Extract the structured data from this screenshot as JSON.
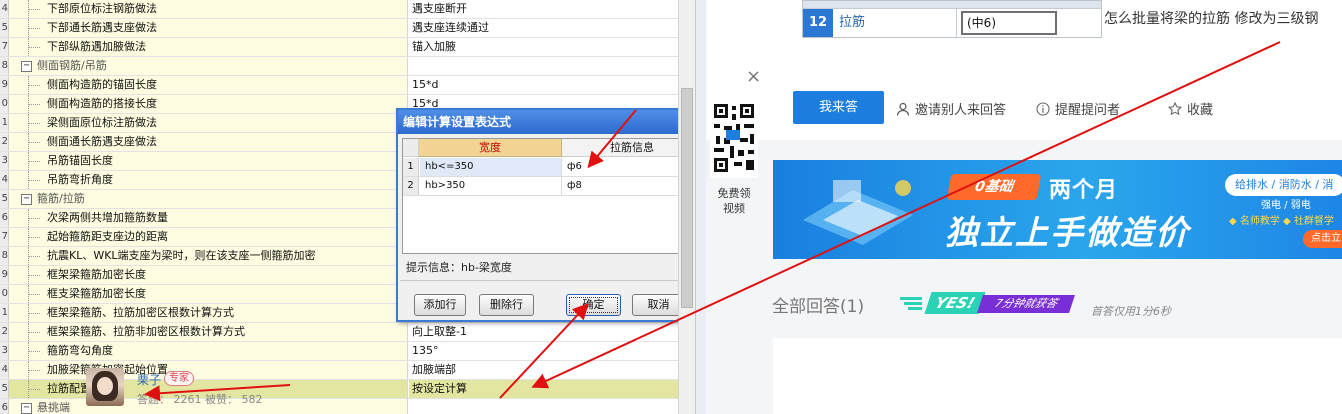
{
  "settings_grid": {
    "rows": [
      {
        "num": "4",
        "label": "下部原位标注钢筋做法",
        "value": "遇支座断开",
        "kind": "item"
      },
      {
        "num": "5",
        "label": "下部通长筋遇支座做法",
        "value": "遇支座连续通过",
        "kind": "item"
      },
      {
        "num": "7",
        "label": "下部纵筋遇加腋做法",
        "value": "锚入加腋",
        "kind": "item"
      },
      {
        "num": "8",
        "label": "侧面钢筋/吊筋",
        "value": "",
        "kind": "section"
      },
      {
        "num": "9",
        "label": "侧面构造筋的锚固长度",
        "value": "15*d",
        "kind": "item"
      },
      {
        "num": "0",
        "label": "侧面构造筋的搭接长度",
        "value": "15*d",
        "kind": "item"
      },
      {
        "num": "1",
        "label": "梁侧面原位标注筋做法",
        "value": "",
        "kind": "item"
      },
      {
        "num": "2",
        "label": "侧面通长筋遇支座做法",
        "value": "",
        "kind": "item"
      },
      {
        "num": "3",
        "label": "吊筋锚固长度",
        "value": "",
        "kind": "item"
      },
      {
        "num": "4",
        "label": "吊筋弯折角度",
        "value": "",
        "kind": "item"
      },
      {
        "num": "5",
        "label": "箍筋/拉筋",
        "value": "",
        "kind": "section"
      },
      {
        "num": "6",
        "label": "次梁两侧共增加箍筋数量",
        "value": "",
        "kind": "item"
      },
      {
        "num": "7",
        "label": "起始箍筋距支座边的距离",
        "value": "",
        "kind": "item"
      },
      {
        "num": "8",
        "label": "抗震KL、WKL端支座为梁时，则在该支座一侧箍筋加密",
        "value": "",
        "kind": "item"
      },
      {
        "num": "9",
        "label": "框架梁箍筋加密长度",
        "value": "",
        "kind": "item"
      },
      {
        "num": "0",
        "label": "框支梁箍筋加密长度",
        "value": "",
        "kind": "item"
      },
      {
        "num": "1",
        "label": "框架梁箍筋、拉筋加密区根数计算方式",
        "value": "",
        "kind": "item"
      },
      {
        "num": "2",
        "label": "框架梁箍筋、拉筋非加密区根数计算方式",
        "value": "向上取整-1",
        "kind": "item"
      },
      {
        "num": "3",
        "label": "箍筋弯勾角度",
        "value": "135°",
        "kind": "item"
      },
      {
        "num": "4",
        "label": "加腋梁箍筋加密起始位置",
        "value": "加腋端部",
        "kind": "item"
      },
      {
        "num": "5",
        "label": "拉筋配置",
        "value": "按设定计算",
        "kind": "item",
        "highlight": true
      },
      {
        "num": "6",
        "label": "悬挑端",
        "value": "",
        "kind": "section"
      }
    ]
  },
  "dialog": {
    "title": "编辑计算设置表达式",
    "close_glyph": "✕",
    "col_width": "宽度",
    "col_tie": "拉筋信息",
    "rows": [
      {
        "n": "1",
        "width": "hb<=350",
        "tie": "ф6"
      },
      {
        "n": "2",
        "width": "hb>350",
        "tie": "ф8"
      }
    ],
    "hint": "提示信息：hb-梁宽度",
    "add_label": "添加行",
    "delete_label": "删除行",
    "ok_label": "确定",
    "cancel_label": "取消"
  },
  "web": {
    "mini_table": {
      "num": "12",
      "key": "拉筋",
      "value": "(中6)"
    },
    "question": "怎么批量将梁的拉筋 修改为三级钢",
    "close_glyph": "×",
    "qr_caption_1": "免费领",
    "qr_caption_2": "视频",
    "answer_button": "我来答",
    "invite": "邀请别人来回答",
    "remind": "提醒提问者",
    "collect": "收藏",
    "banner": {
      "tag": "0基础",
      "line1": "两个月",
      "line2": "独立上手做造价",
      "pill": "给排水 / 消防水 / 消",
      "sub1": "强电 / 弱电",
      "sub2": "◆ 名师教学  ◆ 社群督学",
      "cta": "点击立"
    },
    "answers_title": "全部回答(1)",
    "badge_yes": "YES!",
    "badge_text": "7分钟就获答",
    "first_answer": "首答仅用1分6秒",
    "user": {
      "name": "栗子",
      "role": "专家",
      "stats": "答题： 2261    被赞： 582"
    }
  },
  "colors": {
    "accent_blue": "#1e7ee0",
    "dialog_title": "#2c6acd",
    "header_red": "#c40000",
    "arrow_red": "#e01010",
    "highlight_row": "#e3e6a0"
  }
}
